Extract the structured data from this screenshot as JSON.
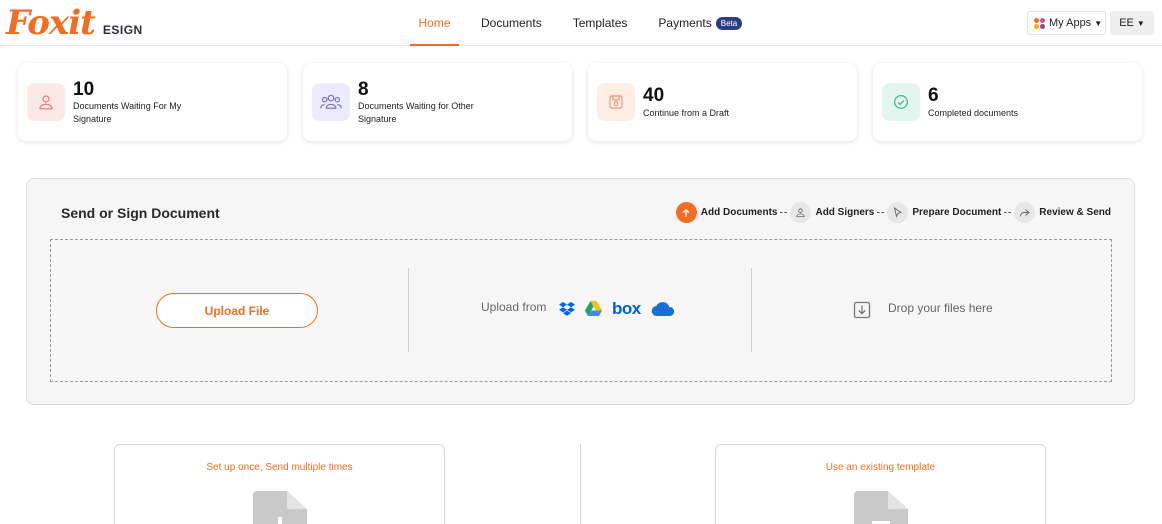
{
  "header": {
    "logo_text": "Foxit",
    "logo_sub": "ESIGN",
    "nav": [
      {
        "label": "Home",
        "active": true
      },
      {
        "label": "Documents",
        "active": false
      },
      {
        "label": "Templates",
        "active": false
      },
      {
        "label": "Payments",
        "active": false,
        "badge": "Beta"
      }
    ],
    "apps_label": "My Apps",
    "apps_icon": "apps-grid-icon",
    "user_initials": "EE"
  },
  "stats": [
    {
      "count": "10",
      "label": "Documents Waiting For My Signature",
      "icon": "user-icon",
      "color": "#fde8e8",
      "icon_color": "#e67a7a"
    },
    {
      "count": "8",
      "label": "Documents Waiting for Other Signature",
      "icon": "users-icon",
      "color": "#ecebfb",
      "icon_color": "#7b74d8"
    },
    {
      "count": "40",
      "label": "Continue from a Draft",
      "icon": "save-icon",
      "color": "#fdeee6",
      "icon_color": "#ee9a73"
    },
    {
      "count": "6",
      "label": "Completed documents",
      "icon": "check-circle-icon",
      "color": "#e3f5ef",
      "icon_color": "#3cb58a"
    }
  ],
  "send_panel": {
    "title": "Send or Sign Document",
    "steps": [
      {
        "label": "Add Documents",
        "icon": "upload-icon",
        "active": true
      },
      {
        "label": "Add Signers",
        "icon": "user-icon",
        "active": false
      },
      {
        "label": "Prepare Document",
        "icon": "cursor-icon",
        "active": false
      },
      {
        "label": "Review & Send",
        "icon": "share-icon",
        "active": false
      }
    ],
    "upload_button": "Upload File",
    "upload_from": "Upload from",
    "cloud_sources": [
      "dropbox-icon",
      "google-drive-icon",
      "box-icon",
      "onedrive-icon"
    ],
    "box_text": "box",
    "drop_text": "Drop your files here"
  },
  "templates": {
    "left_title": "Set up once, Send multiple times",
    "right_title": "Use an existing template"
  },
  "colors": {
    "accent": "#f26c21",
    "beta_badge": "#2c3e7f"
  }
}
